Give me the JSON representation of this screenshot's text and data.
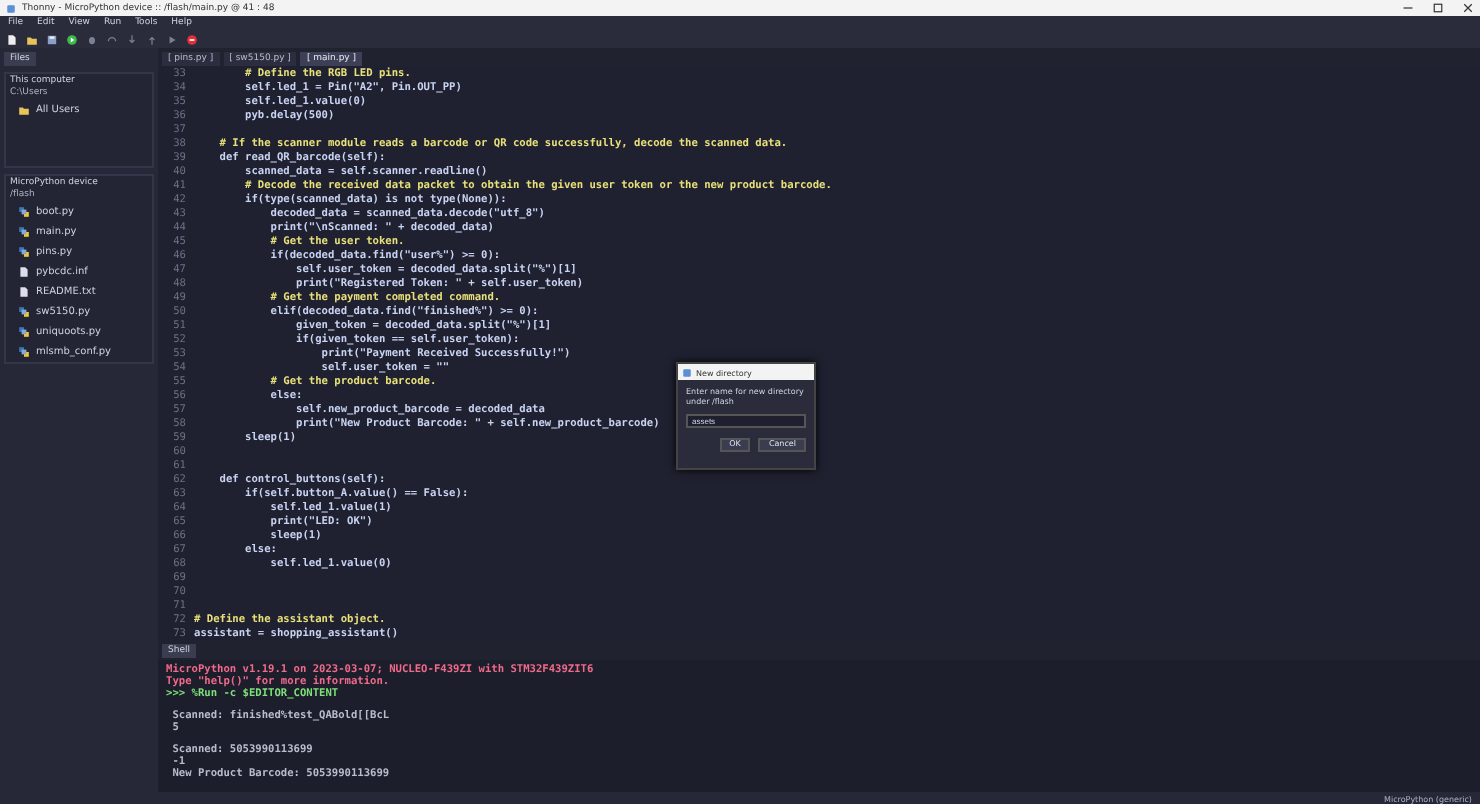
{
  "window": {
    "title": "Thonny - MicroPython device :: /flash/main.py @ 41 : 48"
  },
  "menu": [
    "File",
    "Edit",
    "View",
    "Run",
    "Tools",
    "Help"
  ],
  "files": {
    "title": "Files",
    "computer": {
      "title": "This computer",
      "path": "C:\\Users",
      "items": [
        "All Users"
      ]
    },
    "device": {
      "title": "MicroPython device",
      "path": "/flash",
      "items": [
        {
          "name": "boot.py",
          "kind": "py"
        },
        {
          "name": "main.py",
          "kind": "py"
        },
        {
          "name": "pins.py",
          "kind": "py"
        },
        {
          "name": "pybcdc.inf",
          "kind": "doc"
        },
        {
          "name": "README.txt",
          "kind": "doc"
        },
        {
          "name": "sw5150.py",
          "kind": "py"
        },
        {
          "name": "uniquoots.py",
          "kind": "py"
        },
        {
          "name": "mlsmb_conf.py",
          "kind": "py"
        }
      ]
    }
  },
  "tabs": [
    {
      "label": "[ pins.py ]",
      "selected": false
    },
    {
      "label": "[ sw5150.py ]",
      "selected": false
    },
    {
      "label": "[ main.py ]",
      "selected": true
    }
  ],
  "code": [
    {
      "num": "33",
      "text": "        # Define the RGB LED pins.",
      "kind": "comment"
    },
    {
      "num": "34",
      "text": "        self.led_1 = Pin(\"A2\", Pin.OUT_PP)",
      "kind": "code"
    },
    {
      "num": "35",
      "text": "        self.led_1.value(0)",
      "kind": "code"
    },
    {
      "num": "36",
      "text": "        pyb.delay(500)",
      "kind": "code"
    },
    {
      "num": "37",
      "kind": "blank"
    },
    {
      "num": "38",
      "text": "    # If the scanner module reads a barcode or QR code successfully, decode the scanned data.",
      "kind": "comment"
    },
    {
      "num": "39",
      "text": "    def read_QR_barcode(self):",
      "kind": "code"
    },
    {
      "num": "40",
      "text": "        scanned_data = self.scanner.readline()",
      "kind": "code"
    },
    {
      "num": "41",
      "text": "        # Decode the received data packet to obtain the given user token or the new product barcode.",
      "kind": "comment"
    },
    {
      "num": "42",
      "text": "        if(type(scanned_data) is not type(None)):",
      "kind": "code"
    },
    {
      "num": "43",
      "text": "            decoded_data = scanned_data.decode(\"utf_8\")",
      "kind": "code"
    },
    {
      "num": "44",
      "text": "            print(\"\\nScanned: \" + decoded_data)",
      "kind": "code"
    },
    {
      "num": "45",
      "text": "            # Get the user token.",
      "kind": "comment"
    },
    {
      "num": "46",
      "text": "            if(decoded_data.find(\"user%\") >= 0):",
      "kind": "code"
    },
    {
      "num": "47",
      "text": "                self.user_token = decoded_data.split(\"%\")[1]",
      "kind": "code"
    },
    {
      "num": "48",
      "text": "                print(\"Registered Token: \" + self.user_token)",
      "kind": "code"
    },
    {
      "num": "49",
      "text": "            # Get the payment completed command.",
      "kind": "comment"
    },
    {
      "num": "50",
      "text": "            elif(decoded_data.find(\"finished%\") >= 0):",
      "kind": "code"
    },
    {
      "num": "51",
      "text": "                given_token = decoded_data.split(\"%\")[1]",
      "kind": "code"
    },
    {
      "num": "52",
      "text": "                if(given_token == self.user_token):",
      "kind": "code"
    },
    {
      "num": "53",
      "text": "                    print(\"Payment Received Successfully!\")",
      "kind": "code"
    },
    {
      "num": "54",
      "text": "                    self.user_token = \"\"",
      "kind": "code"
    },
    {
      "num": "55",
      "text": "            # Get the product barcode.",
      "kind": "comment"
    },
    {
      "num": "56",
      "text": "            else:",
      "kind": "code"
    },
    {
      "num": "57",
      "text": "                self.new_product_barcode = decoded_data",
      "kind": "code"
    },
    {
      "num": "58",
      "text": "                print(\"New Product Barcode: \" + self.new_product_barcode)",
      "kind": "code"
    },
    {
      "num": "59",
      "text": "        sleep(1)",
      "kind": "code"
    },
    {
      "num": "60",
      "kind": "blank"
    },
    {
      "num": "61",
      "kind": "blank"
    },
    {
      "num": "62",
      "text": "    def control_buttons(self):",
      "kind": "code"
    },
    {
      "num": "63",
      "text": "        if(self.button_A.value() == False):",
      "kind": "code"
    },
    {
      "num": "64",
      "text": "            self.led_1.value(1)",
      "kind": "code"
    },
    {
      "num": "65",
      "text": "            print(\"LED: OK\")",
      "kind": "code"
    },
    {
      "num": "66",
      "text": "            sleep(1)",
      "kind": "code"
    },
    {
      "num": "67",
      "text": "        else:",
      "kind": "code"
    },
    {
      "num": "68",
      "text": "            self.led_1.value(0)",
      "kind": "code"
    },
    {
      "num": "69",
      "kind": "blank"
    },
    {
      "num": "70",
      "kind": "blank"
    },
    {
      "num": "71",
      "kind": "blank"
    },
    {
      "num": "72",
      "text": "# Define the assistant object.",
      "kind": "comment"
    },
    {
      "num": "73",
      "text": "assistant = shopping_assistant()",
      "kind": "code"
    }
  ],
  "shell": {
    "title": "Shell",
    "lines": [
      {
        "text": "MicroPython v1.19.1 on 2023-03-07; NUCLEO-F439ZI with STM32F439ZIT6",
        "kind": "banner"
      },
      {
        "text": "Type \"help()\" for more information.",
        "kind": "banner"
      },
      {
        "text": ">>> %Run -c $EDITOR_CONTENT",
        "kind": "prompt"
      },
      {
        "kind": "blank"
      },
      {
        "text": " Scanned: finished%test_QABold[[BcL",
        "kind": "output"
      },
      {
        "text": " 5",
        "kind": "output"
      },
      {
        "kind": "blank"
      },
      {
        "text": " Scanned: 5053990113699",
        "kind": "output"
      },
      {
        "text": " -1",
        "kind": "output"
      },
      {
        "text": " New Product Barcode: 5053990113699",
        "kind": "output"
      }
    ]
  },
  "dialog": {
    "title": "New directory",
    "message": "Enter name for new directory under /flash",
    "value": "assets",
    "buttons": [
      "OK",
      "Cancel"
    ]
  },
  "status_bar": "MicroPython (generic)"
}
